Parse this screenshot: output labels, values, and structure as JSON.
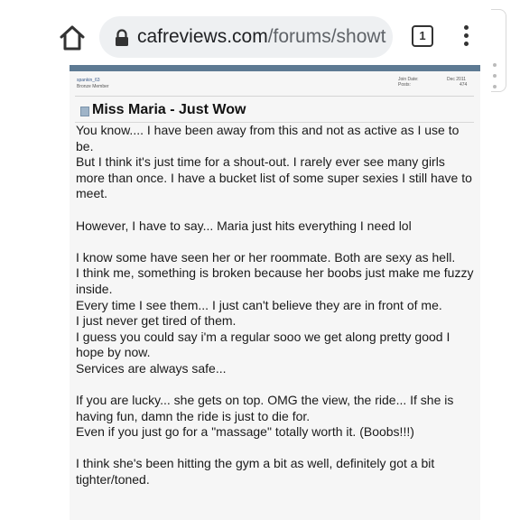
{
  "browser": {
    "url_domain": "cafreviews.com",
    "url_path": "/forums/showtl",
    "tab_count": "1",
    "home_icon": "home-icon",
    "lock_icon": "lock-icon",
    "menu_icon": "kebab-menu-icon"
  },
  "post": {
    "author": "spankin_63",
    "rank": "Bronze Member",
    "join_label": "Join Date:",
    "join_value": "Dec 2011",
    "posts_label": "Posts:",
    "posts_value": "474",
    "title": "Miss Maria - Just Wow",
    "body_lines": [
      "You know.... I have been away from this and not as active as I use to be.",
      "But I think it's just time for a shout-out. I rarely ever see many girls more than once. I have a bucket list of some super sexies I still have to meet.",
      "",
      "However, I have to say... Maria just hits everything I need lol",
      "",
      "I know some have seen her or her roommate. Both are sexy as hell.",
      "I think me, something is broken because her boobs just make me fuzzy inside.",
      "Every time I see them... I just can't believe they are in front of me.",
      "I just never get tired of them.",
      "I guess you could say i'm a regular sooo we get along pretty good I hope by now.",
      "Services are always safe...",
      "",
      "If you are lucky... she gets on top. OMG the view, the ride... If she is having fun, damn the ride is just to die for.",
      "Even if you just go for a \"massage\" totally worth it. (Boobs!!!)",
      "",
      "I think she's been hitting the gym a bit as well, definitely got a bit tighter/toned."
    ]
  },
  "colors": {
    "page_background": "#f6f6f6",
    "forum_header": "#5d7a93",
    "urlbar": "#eef0f2"
  }
}
